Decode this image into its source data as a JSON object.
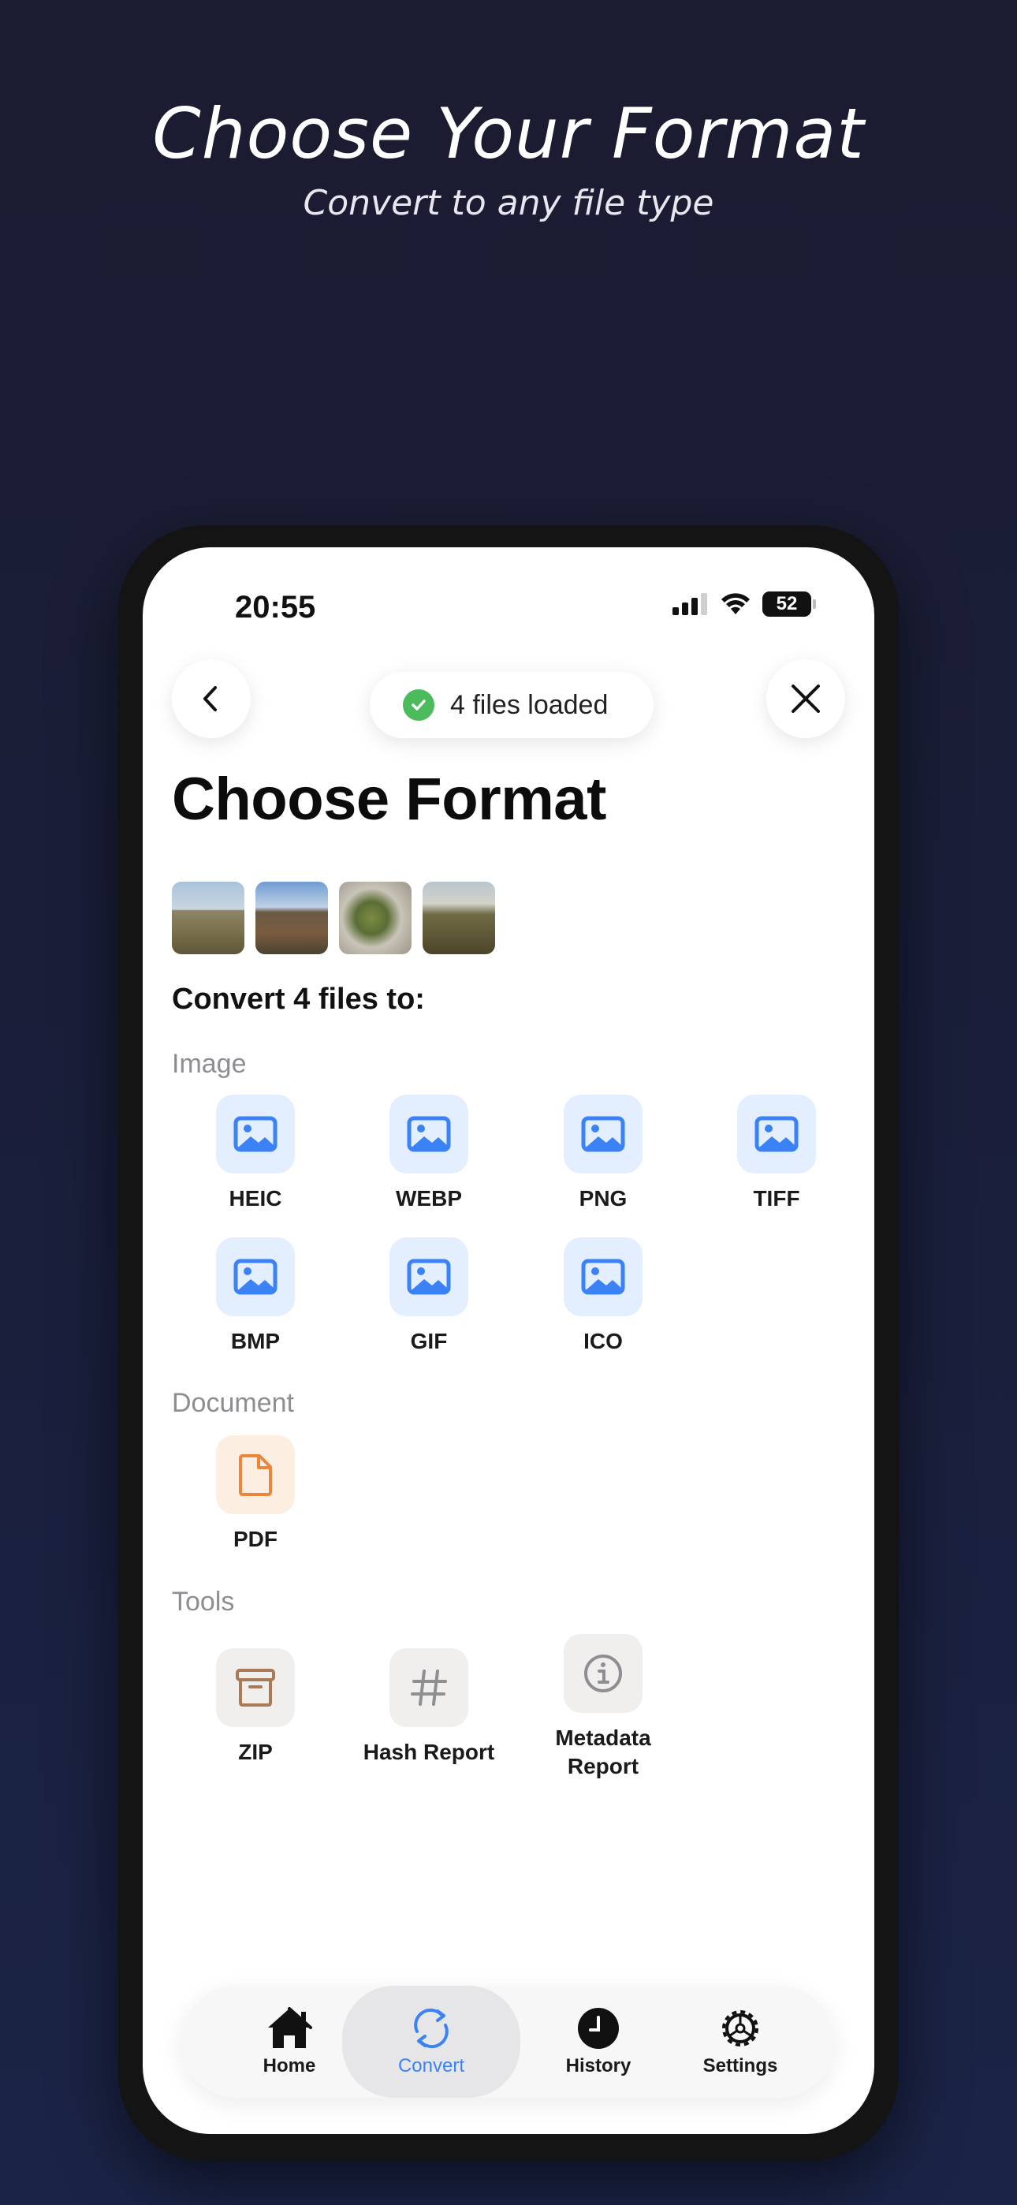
{
  "hero": {
    "title": "Choose Your Format",
    "subtitle": "Convert to any file type"
  },
  "status_bar": {
    "time": "20:55",
    "battery": "52",
    "icons": [
      "cellular-signal-icon",
      "wifi-icon",
      "battery-icon"
    ]
  },
  "nav": {
    "back_icon": "chevron-left-icon",
    "close_icon": "close-icon"
  },
  "toast": {
    "text": "4 files loaded",
    "icon": "check-circle-icon"
  },
  "page_title": "Choose Format",
  "thumbnails": [
    "photo-1",
    "photo-2",
    "photo-3",
    "photo-4"
  ],
  "convert_heading": "Convert 4 files to:",
  "sections": {
    "image": {
      "label": "Image",
      "formats": [
        "HEIC",
        "WEBP",
        "PNG",
        "TIFF",
        "BMP",
        "GIF",
        "ICO"
      ]
    },
    "document": {
      "label": "Document",
      "formats": [
        "PDF"
      ]
    },
    "tools": {
      "label": "Tools",
      "items": [
        "ZIP",
        "Hash Report",
        "Metadata\nReport"
      ]
    }
  },
  "tabbar": {
    "items": [
      {
        "label": "Home",
        "icon": "home-icon"
      },
      {
        "label": "Convert",
        "icon": "convert-arrows-icon"
      },
      {
        "label": "History",
        "icon": "clock-icon"
      },
      {
        "label": "Settings",
        "icon": "gear-icon"
      }
    ],
    "active": "Convert"
  },
  "colors": {
    "accent_blue": "#3b82f6",
    "pdf_orange": "#e9883d",
    "zip_brown": "#a97a55",
    "success_green": "#4cbb5c"
  }
}
